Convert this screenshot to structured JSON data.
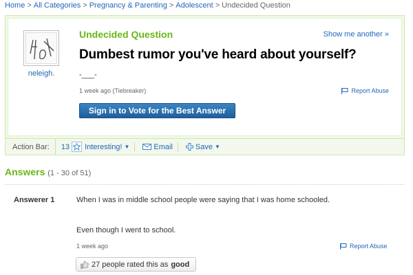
{
  "breadcrumb": {
    "items": [
      "Home",
      "All Categories",
      "Pregnancy & Parenting",
      "Adolescent"
    ],
    "current": "Undecided Question",
    "separator": ">"
  },
  "question": {
    "status_title": "Undecided Question",
    "show_another": "Show me another »",
    "text": "Dumbest rumor you've heard about yourself?",
    "detail": "-___-",
    "meta": "1 week ago (Tiebreaker)",
    "report_label": "Report Abuse",
    "vote_button": "Sign in to Vote for the Best Answer",
    "asker_name": "neleigh."
  },
  "action_bar": {
    "label": "Action Bar:",
    "count": "13",
    "interesting_label": "Interesting!",
    "email_label": "Email",
    "save_label": "Save"
  },
  "answers": {
    "heading": "Answers",
    "count_text": "(1 - 30 of 51)",
    "items": [
      {
        "answerer": "Answerer 1",
        "text_line1": "When I was in middle school people were saying that I was home schooled.",
        "text_line2": "Even though I went to school.",
        "meta": "1 week ago",
        "report_label": "Report Abuse",
        "rating_prefix": "27 people rated this as",
        "rating_value": "good"
      }
    ]
  },
  "colors": {
    "accent_green": "#6ab619",
    "link_blue": "#2266bb",
    "button_blue": "#2a70b0"
  }
}
